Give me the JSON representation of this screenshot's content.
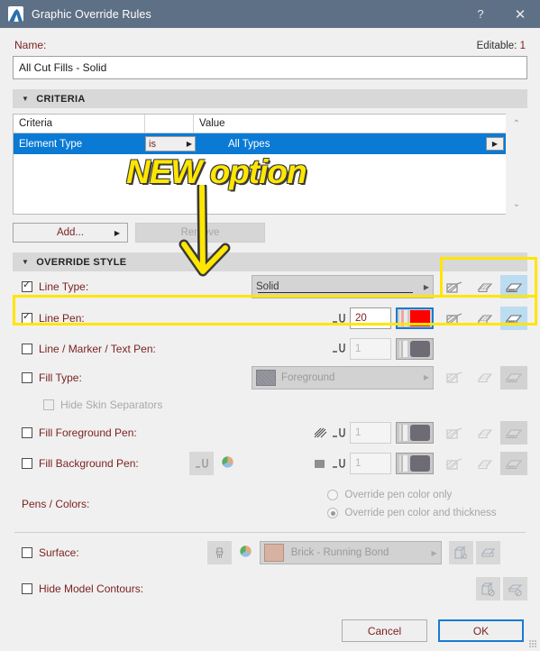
{
  "window": {
    "title": "Graphic Override Rules",
    "icon": "archicad-app-icon",
    "help_label": "?",
    "close_label": "✕"
  },
  "name_section": {
    "label": "Name:",
    "editable_label": "Editable:",
    "editable_count": "1",
    "value": "All Cut Fills - Solid",
    "placeholder": "Name"
  },
  "criteria": {
    "section_title": "CRITERIA",
    "columns": [
      "Criteria",
      "",
      "Value"
    ],
    "rows": [
      {
        "name": "Element Type",
        "operator": "is",
        "value": "All Types",
        "selected": true
      }
    ],
    "scroll_up": "⌃",
    "scroll_down": "⌄",
    "add_label": "Add...",
    "remove_label": "Remove"
  },
  "override_style": {
    "section_title": "OVERRIDE STYLE",
    "rows": [
      {
        "label": "Line Type:",
        "checked": true,
        "enabled": true,
        "combo_value": "Solid",
        "selected_toggle": 2
      },
      {
        "label": "Line Pen:",
        "checked": true,
        "enabled": true,
        "pen_value": "20",
        "color": "#ff0000",
        "selected_toggle": 2
      },
      {
        "label": "Line / Marker / Text Pen:",
        "checked": false,
        "enabled": false,
        "pen_value": "1"
      },
      {
        "label": "Fill Type:",
        "checked": false,
        "enabled": false,
        "combo_value": "Foreground"
      },
      {
        "label": "Hide Skin Separators",
        "checked": false,
        "enabled": false
      },
      {
        "label": "Fill Foreground Pen:",
        "checked": false,
        "enabled": false,
        "pen_value": "1"
      },
      {
        "label": "Fill Background Pen:",
        "checked": false,
        "enabled": false,
        "pen_value": "1"
      }
    ],
    "pens_colors": {
      "label": "Pens / Colors:",
      "options": [
        {
          "label": "Override pen color only",
          "selected": false
        },
        {
          "label": "Override pen color and thickness",
          "selected": true
        }
      ]
    },
    "surface": {
      "label": "Surface:",
      "checked": false,
      "value": "Brick - Running Bond"
    },
    "hide_model_contours": {
      "label": "Hide Model Contours:",
      "checked": false
    }
  },
  "footer": {
    "cancel_label": "Cancel",
    "ok_label": "OK"
  },
  "annotation": {
    "text": "NEW option",
    "color": "#ffe600"
  },
  "colors": {
    "titlebar": "#5e7085",
    "selection": "#0a7ad5",
    "label_text": "#7b1f1f",
    "highlight": "#ffe600",
    "line_pen_color": "#ff0000"
  }
}
